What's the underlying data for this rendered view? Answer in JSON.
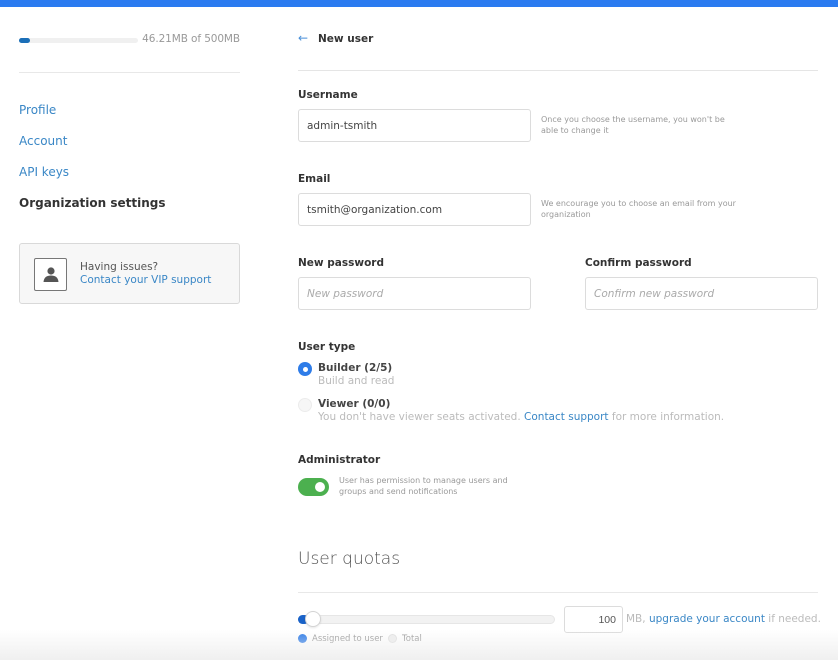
{
  "colors": {
    "topbar": "#2b7bf0",
    "link": "#3a87c6",
    "primary": "#2e7ce8",
    "toggle_on": "#4cb04f",
    "storage_fill": "#1b6fb8"
  },
  "sidebar": {
    "storage": {
      "used_mb": 46.21,
      "total_mb": 500,
      "text": "46.21MB of 500MB"
    },
    "items": [
      {
        "label": "Profile",
        "active": false
      },
      {
        "label": "Account",
        "active": false
      },
      {
        "label": "API keys",
        "active": false
      },
      {
        "label": "Organization settings",
        "active": true
      }
    ],
    "support": {
      "icon": "user-icon",
      "title": "Having issues?",
      "link": "Contact your VIP support"
    }
  },
  "header": {
    "back_icon": "arrow-left-icon",
    "back_glyph": "←",
    "title": "New user"
  },
  "form": {
    "username": {
      "label": "Username",
      "value": "admin-tsmith",
      "hint": "Once you choose the username, you won't be able to change it"
    },
    "email": {
      "label": "Email",
      "value": "tsmith@organization.com",
      "hint": "We encourage you to choose an email from your organization"
    },
    "new_password": {
      "label": "New password",
      "placeholder": "New password",
      "value": ""
    },
    "confirm_password": {
      "label": "Confirm password",
      "placeholder": "Confirm new password",
      "value": ""
    },
    "user_type": {
      "label": "User type",
      "options": [
        {
          "label": "Builder (2/5)",
          "description": "Build and read",
          "selected": true,
          "disabled": false
        },
        {
          "label": "Viewer (0/0)",
          "description_before": "You don't have viewer seats activated.",
          "description_link": "Contact support",
          "description_after": "for more information.",
          "selected": false,
          "disabled": true
        }
      ]
    },
    "administrator": {
      "label": "Administrator",
      "enabled": true,
      "hint": "User has permission to manage users and groups and send notifications"
    }
  },
  "quotas": {
    "title": "User quotas",
    "value": "100",
    "unit": "MB,",
    "link": "upgrade your account",
    "after_link": "if needed.",
    "slider_fraction": 0.02,
    "legend": [
      {
        "label": "Assigned to user",
        "color": "#2e7ce8"
      },
      {
        "label": "Total",
        "color": "#eeeeee"
      }
    ]
  }
}
